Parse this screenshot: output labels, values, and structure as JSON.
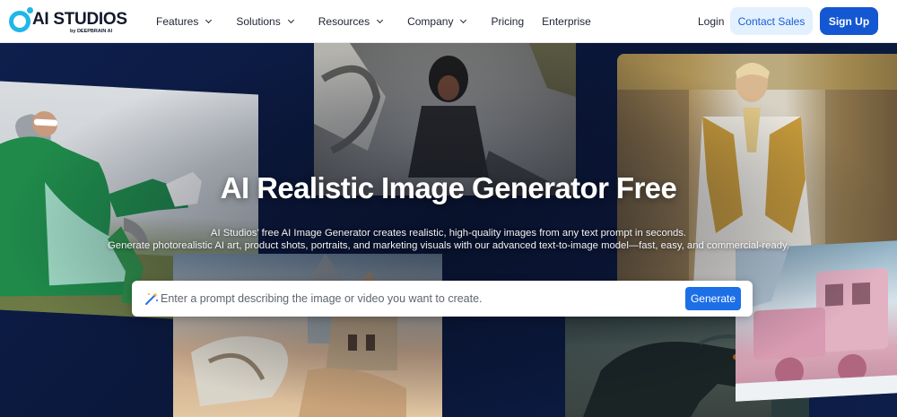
{
  "brand": {
    "name": "AI STUDIOS",
    "sub": "by DEEPBRAIN AI"
  },
  "nav": {
    "items": [
      {
        "label": "Features",
        "dropdown": true
      },
      {
        "label": "Solutions",
        "dropdown": true
      },
      {
        "label": "Resources",
        "dropdown": true
      },
      {
        "label": "Company",
        "dropdown": true
      },
      {
        "label": "Pricing",
        "dropdown": false
      },
      {
        "label": "Enterprise",
        "dropdown": false
      }
    ],
    "login": "Login",
    "contact_sales": "Contact Sales",
    "sign_up": "Sign Up"
  },
  "hero": {
    "title": "AI Realistic Image Generator Free",
    "subtitle_line1": "AI Studios’ free AI Image Generator creates realistic, high-quality images from any text prompt in seconds.",
    "subtitle_line2": "Generate photorealistic AI art, product shots, portraits, and marketing visuals with our advanced text-to-image model—fast, easy, and commercial-ready.",
    "prompt_placeholder": "Enter a prompt describing the image or video you want to create.",
    "generate_label": "Generate"
  },
  "colors": {
    "brand_blue": "#1457d2",
    "accent_cyan": "#1fb7e8",
    "hero_bg": "#0c1a3d"
  },
  "icons": [
    "chevron-down-icon",
    "magic-wand-icon"
  ]
}
